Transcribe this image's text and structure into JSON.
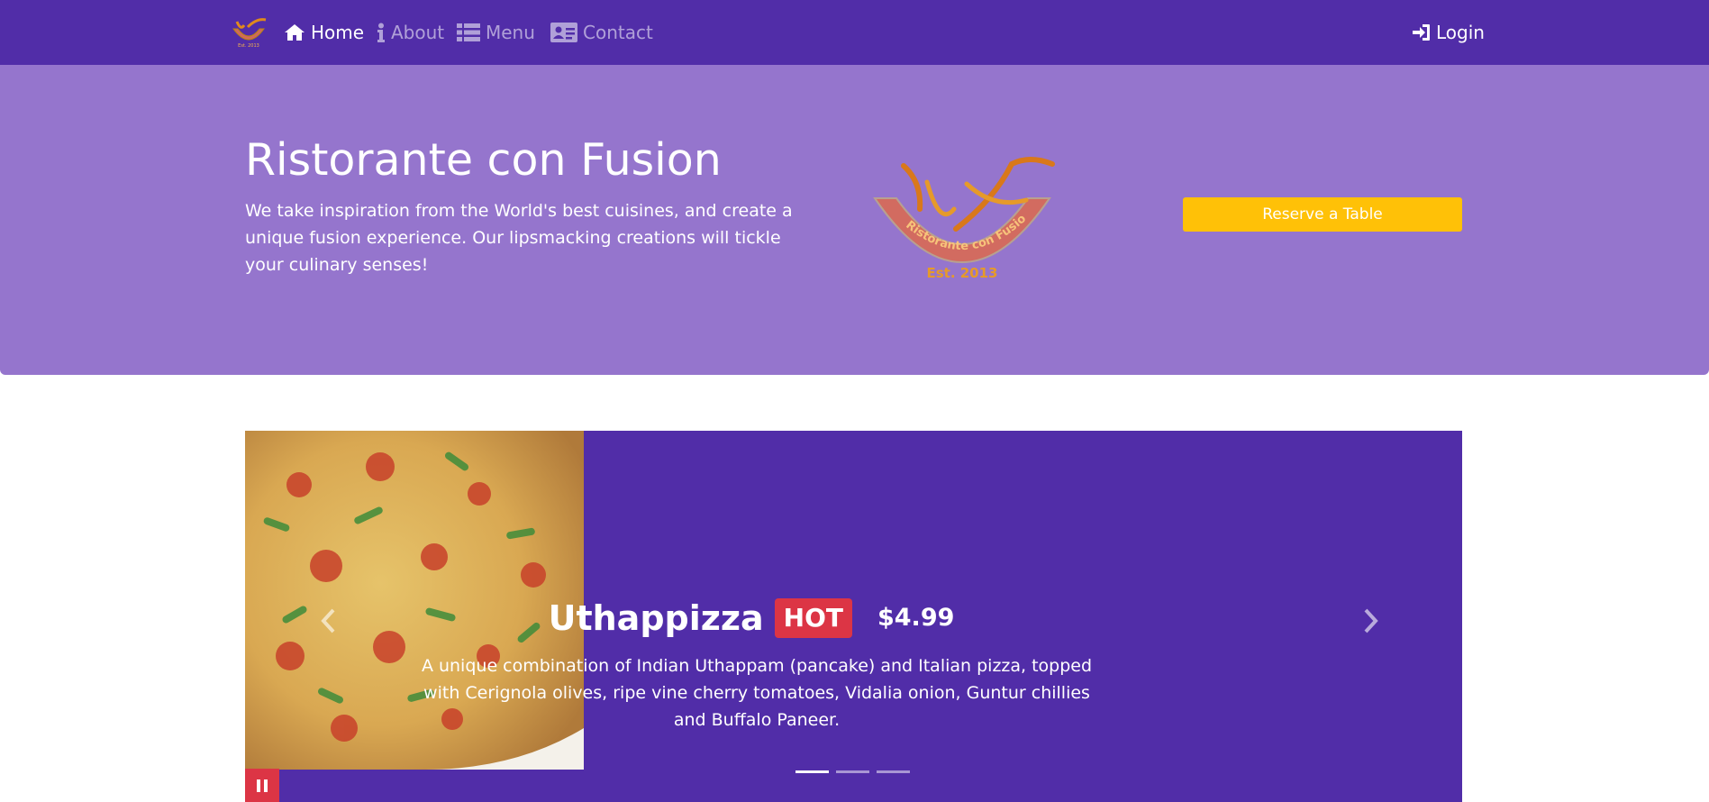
{
  "nav": {
    "brand_icon": "restaurant-logo",
    "items": [
      {
        "label": "Home",
        "icon": "home-icon",
        "active": true
      },
      {
        "label": "About",
        "icon": "info-icon",
        "active": false
      },
      {
        "label": "Menu",
        "icon": "list-icon",
        "active": false
      },
      {
        "label": "Contact",
        "icon": "address-card-icon",
        "active": false
      }
    ],
    "login": {
      "label": "Login",
      "icon": "sign-in-icon"
    }
  },
  "jumbotron": {
    "title": "Ristorante con Fusion",
    "description": "We take inspiration from the World's best cuisines, and create a unique fusion experience. Our lipsmacking creations will tickle your culinary senses!",
    "logo_icon": "restaurant-logo",
    "reserve_button": "Reserve a Table"
  },
  "carousel": {
    "slides_count": 3,
    "active_slide": 0,
    "slide": {
      "title": "Uthappizza",
      "badge": "HOT",
      "price": "$4.99",
      "description": "A unique combination of Indian Uthappam (pancake) and Italian pizza, topped with Cerignola olives, ripe vine cherry tomatoes, Vidalia onion, Guntur chillies and Buffalo Paneer."
    }
  },
  "colors": {
    "primary_dark": "#512DA8",
    "primary_light": "#9575CD",
    "accent": "#FFC107",
    "danger": "#dc3545"
  }
}
